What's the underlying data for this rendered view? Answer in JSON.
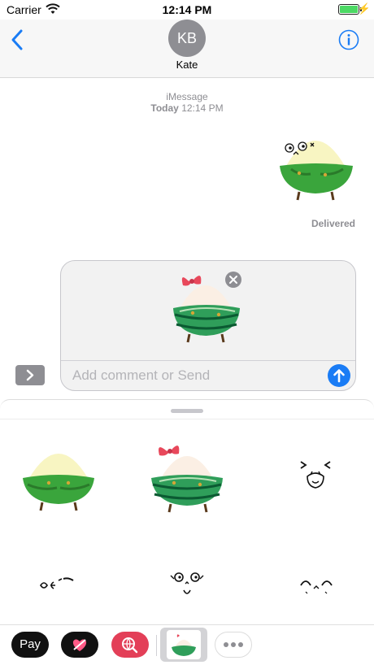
{
  "status_bar": {
    "carrier": "Carrier",
    "time": "12:14 PM",
    "battery_level": 1.0,
    "battery_color": "#4cd964",
    "charging": true
  },
  "header": {
    "back_icon": "chevron-left-icon",
    "avatar_initials": "KB",
    "contact_name": "Kate",
    "info_icon": "info-icon",
    "accent_color": "#1a7cf5"
  },
  "conversation": {
    "service": "iMessage",
    "date_label": "Today",
    "time_label": "12:14 PM",
    "sent_sticker": "rice-dumpling-sticker",
    "delivered": "Delivered"
  },
  "compose": {
    "staged_sticker": "rice-dumpling-bow-sticker",
    "placeholder": "Add comment or Send",
    "send_icon": "arrow-up-icon",
    "expand_icon": "chevron-right-icon"
  },
  "sticker_grid": [
    {
      "name": "rice-dumpling-sticker"
    },
    {
      "name": "rice-dumpling-bow-sticker"
    },
    {
      "name": "laughing-face-sticker"
    },
    {
      "name": "kissing-face-sticker"
    },
    {
      "name": "dazed-face-sticker"
    },
    {
      "name": "smiling-face-sticker"
    }
  ],
  "app_strip": {
    "apple_pay_label": "Pay",
    "apps": [
      "apple-pay-icon",
      "handwriting-icon",
      "web-search-icon",
      "sticker-pack-icon",
      "more-icon"
    ]
  }
}
